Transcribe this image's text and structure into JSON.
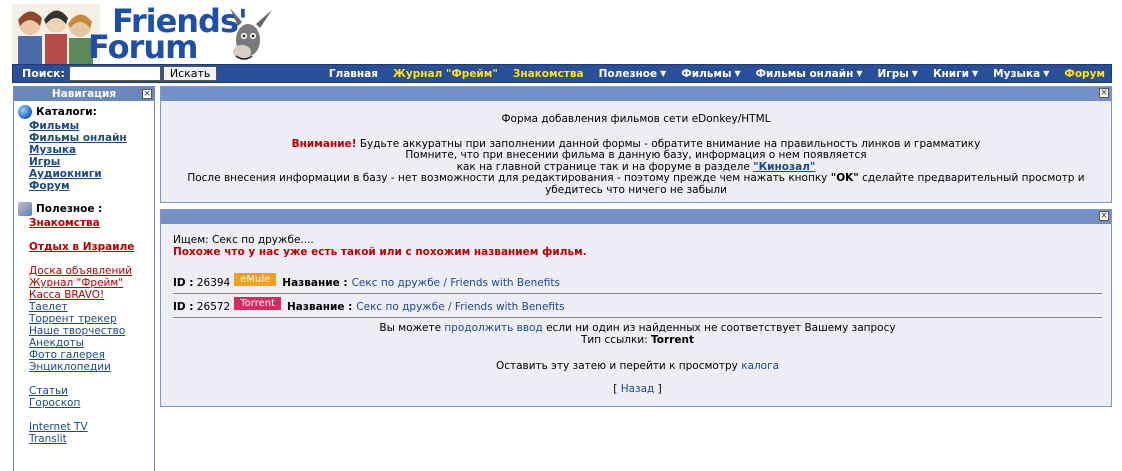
{
  "logo": {
    "line1": "Friends'",
    "line2": "Forum"
  },
  "topbar": {
    "search_label": "Поиск:",
    "search_value": "",
    "search_button": "Искать",
    "nav": [
      {
        "label": "Главная",
        "yellow": false,
        "dropdown": false
      },
      {
        "label": "Журнал \"Фрейм\"",
        "yellow": true,
        "dropdown": false
      },
      {
        "label": "Знакомства",
        "yellow": true,
        "dropdown": false
      },
      {
        "label": "Полезное",
        "yellow": false,
        "dropdown": true
      },
      {
        "label": "Фильмы",
        "yellow": false,
        "dropdown": true
      },
      {
        "label": "Фильмы онлайн",
        "yellow": false,
        "dropdown": true
      },
      {
        "label": "Игры",
        "yellow": false,
        "dropdown": true
      },
      {
        "label": "Книги",
        "yellow": false,
        "dropdown": true
      },
      {
        "label": "Музыка",
        "yellow": false,
        "dropdown": true
      },
      {
        "label": "Форум",
        "yellow": true,
        "dropdown": false
      }
    ]
  },
  "leftnav": {
    "title": "Навигация",
    "catalogs_title": "Каталоги:",
    "catalogs": [
      "Фильмы",
      "Фильмы онлайн",
      "Музыка",
      "Игры",
      "Аудиокниги",
      "Форум"
    ],
    "useful_title": "Полезное :",
    "dating": "Знакомства",
    "israel": "Отдых в Израиле",
    "links1": [
      "Доска объявлений",
      "Журнал \"Фрейм\"",
      "Касса BRAVO!"
    ],
    "links2": [
      "Таелет",
      "Торрент трекер",
      "Наше творчество",
      "Анекдоты",
      "Фото галерея",
      "Энциклопедии"
    ],
    "links3": [
      "Статьи",
      "Гороскоп"
    ],
    "links4": [
      "Internet TV",
      "Translit"
    ]
  },
  "panel1": {
    "title": "Форма добавления фильмов сети eDonkey/HTML",
    "warning_label": "Внимание!",
    "warning_text": " Будьте аккуратны при заполнении данной формы - обратите внимание на правильность линков и грамматику",
    "line2": "Помните, что при внесении фильма в данную базу, информация о нем появляется",
    "line3": "как на главной странице так и на форуме в разделе ",
    "kinozal": "\"Кинозал\"",
    "line4_a": "После внесения информации в базу - нет возможности для редактирования - поэтому прежде чем нажать кнопку ",
    "ok": "\"OK\"",
    "line4_b": " сделайте предварительный просмотр и",
    "line5": "убедитесь что ничего не забыли"
  },
  "panel2": {
    "searching": "Ищем: Секс по дружбе....",
    "found": "Похоже что у нас уже есть такой или с похожим названием фильм.",
    "results": [
      {
        "id_label": "ID :",
        "id": "26394",
        "badge": "eMule",
        "name_label": "Название :",
        "title": "Секс по дружбе / Friends with Benefits"
      },
      {
        "id_label": "ID :",
        "id": "26572",
        "badge": "Torrent",
        "name_label": "Название :",
        "title": "Секс по дружбе / Friends with Benefits"
      }
    ],
    "continue_prefix": "Вы можете ",
    "continue_link": "продолжить ввод",
    "continue_suffix": " если ни один из найденных не соответствует Вашему запросу",
    "type_label": "Тип ссылки: ",
    "type_value": "Torrent",
    "leave_text": "Оставить эту затею и перейти к просмотру ",
    "catalog_link": "калога",
    "back_open": "[ ",
    "back_link": "Назад",
    "back_close": " ]"
  },
  "colors": {
    "bar": "#2a4f99",
    "panel_head": "#7391c7",
    "panel_bg": "#ecedf5",
    "warning": "#c00000",
    "badge_emule": "#f0a020",
    "badge_torrent": "#d42c5e"
  }
}
